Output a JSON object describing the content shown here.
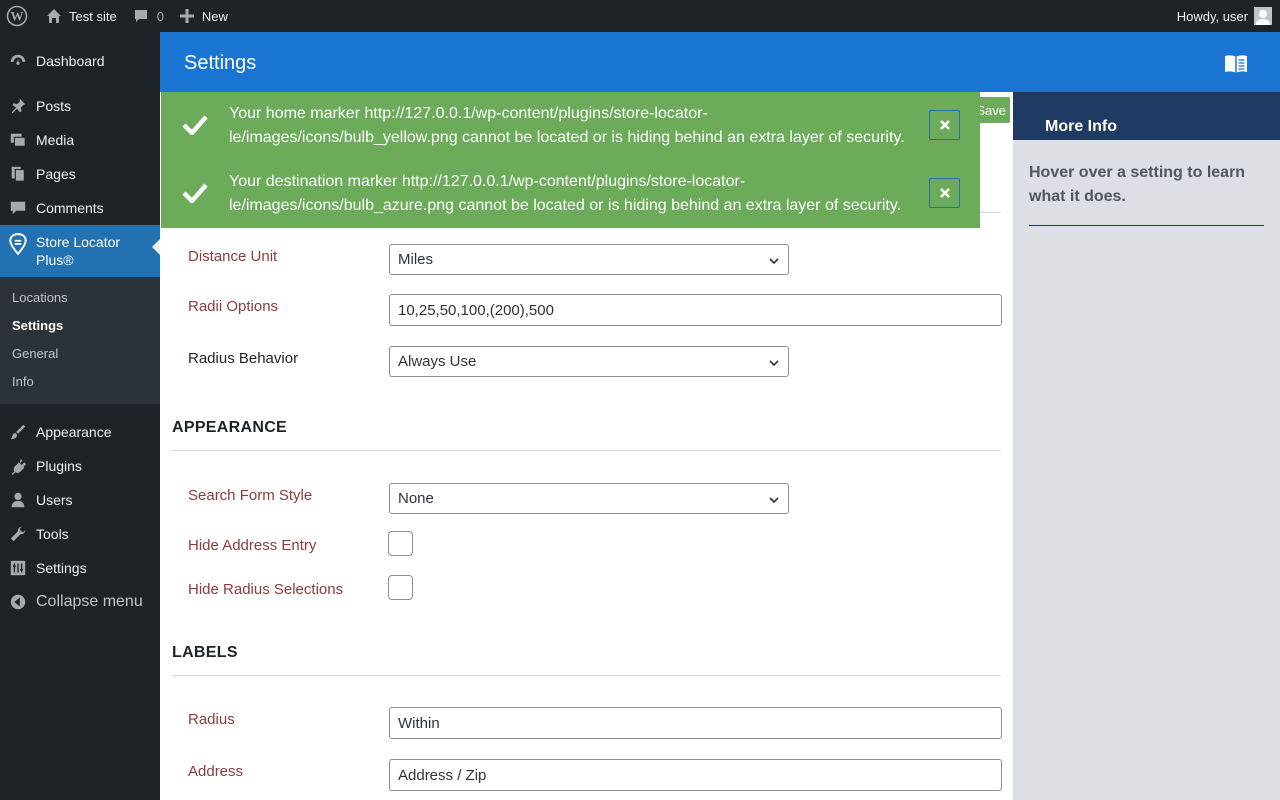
{
  "admin_bar": {
    "site_name": "Test site",
    "comments_count": "0",
    "new_label": "New",
    "greeting": "Howdy, user"
  },
  "sidebar": {
    "items": [
      {
        "label": "Dashboard",
        "icon": "dashboard-icon"
      },
      {
        "label": "Posts",
        "icon": "pushpin-icon"
      },
      {
        "label": "Media",
        "icon": "media-icon"
      },
      {
        "label": "Pages",
        "icon": "pages-icon"
      },
      {
        "label": "Comments",
        "icon": "comment-icon"
      },
      {
        "label": "Store Locator Plus®",
        "icon": "store-locator-icon"
      },
      {
        "label": "Appearance",
        "icon": "brush-icon"
      },
      {
        "label": "Plugins",
        "icon": "plug-icon"
      },
      {
        "label": "Users",
        "icon": "user-icon"
      },
      {
        "label": "Tools",
        "icon": "wrench-icon"
      },
      {
        "label": "Settings",
        "icon": "sliders-icon"
      },
      {
        "label": "Collapse menu",
        "icon": "collapse-icon"
      }
    ],
    "submenu": [
      "Locations",
      "Settings",
      "General",
      "Info"
    ]
  },
  "header": {
    "title": "Settings"
  },
  "save_label": "Save",
  "notices": [
    {
      "text": "Your home marker http://127.0.0.1/wp-content/plugins/store-locator-le/images/icons/bulb_yellow.png cannot be located or is hiding behind an extra layer of security."
    },
    {
      "text": "Your destination marker http://127.0.0.1/wp-content/plugins/store-locator-le/images/icons/bulb_azure.png cannot be located or is hiding behind an extra layer of security."
    }
  ],
  "settings": {
    "distance_unit": {
      "label": "Distance Unit",
      "value": "Miles"
    },
    "radii_options": {
      "label": "Radii Options",
      "value": "10,25,50,100,(200),500"
    },
    "radius_behavior": {
      "label": "Radius Behavior",
      "value": "Always Use"
    },
    "appearance_heading": "APPEARANCE",
    "search_form_style": {
      "label": "Search Form Style",
      "value": "None"
    },
    "hide_address_entry": {
      "label": "Hide Address Entry",
      "checked": false
    },
    "hide_radius_selections": {
      "label": "Hide Radius Selections",
      "checked": false
    },
    "labels_heading": "LABELS",
    "radius_label": {
      "label": "Radius",
      "value": "Within"
    },
    "address_label": {
      "label": "Address",
      "value": "Address / Zip"
    }
  },
  "more_info": {
    "title": "More Info",
    "help_text": "Hover over a setting to learn what it does."
  },
  "colors": {
    "header_blue": "#1a75d2",
    "notice_green": "#6cab5a",
    "label_red": "#8c3c3c",
    "panel_navy": "#1f3b63"
  }
}
